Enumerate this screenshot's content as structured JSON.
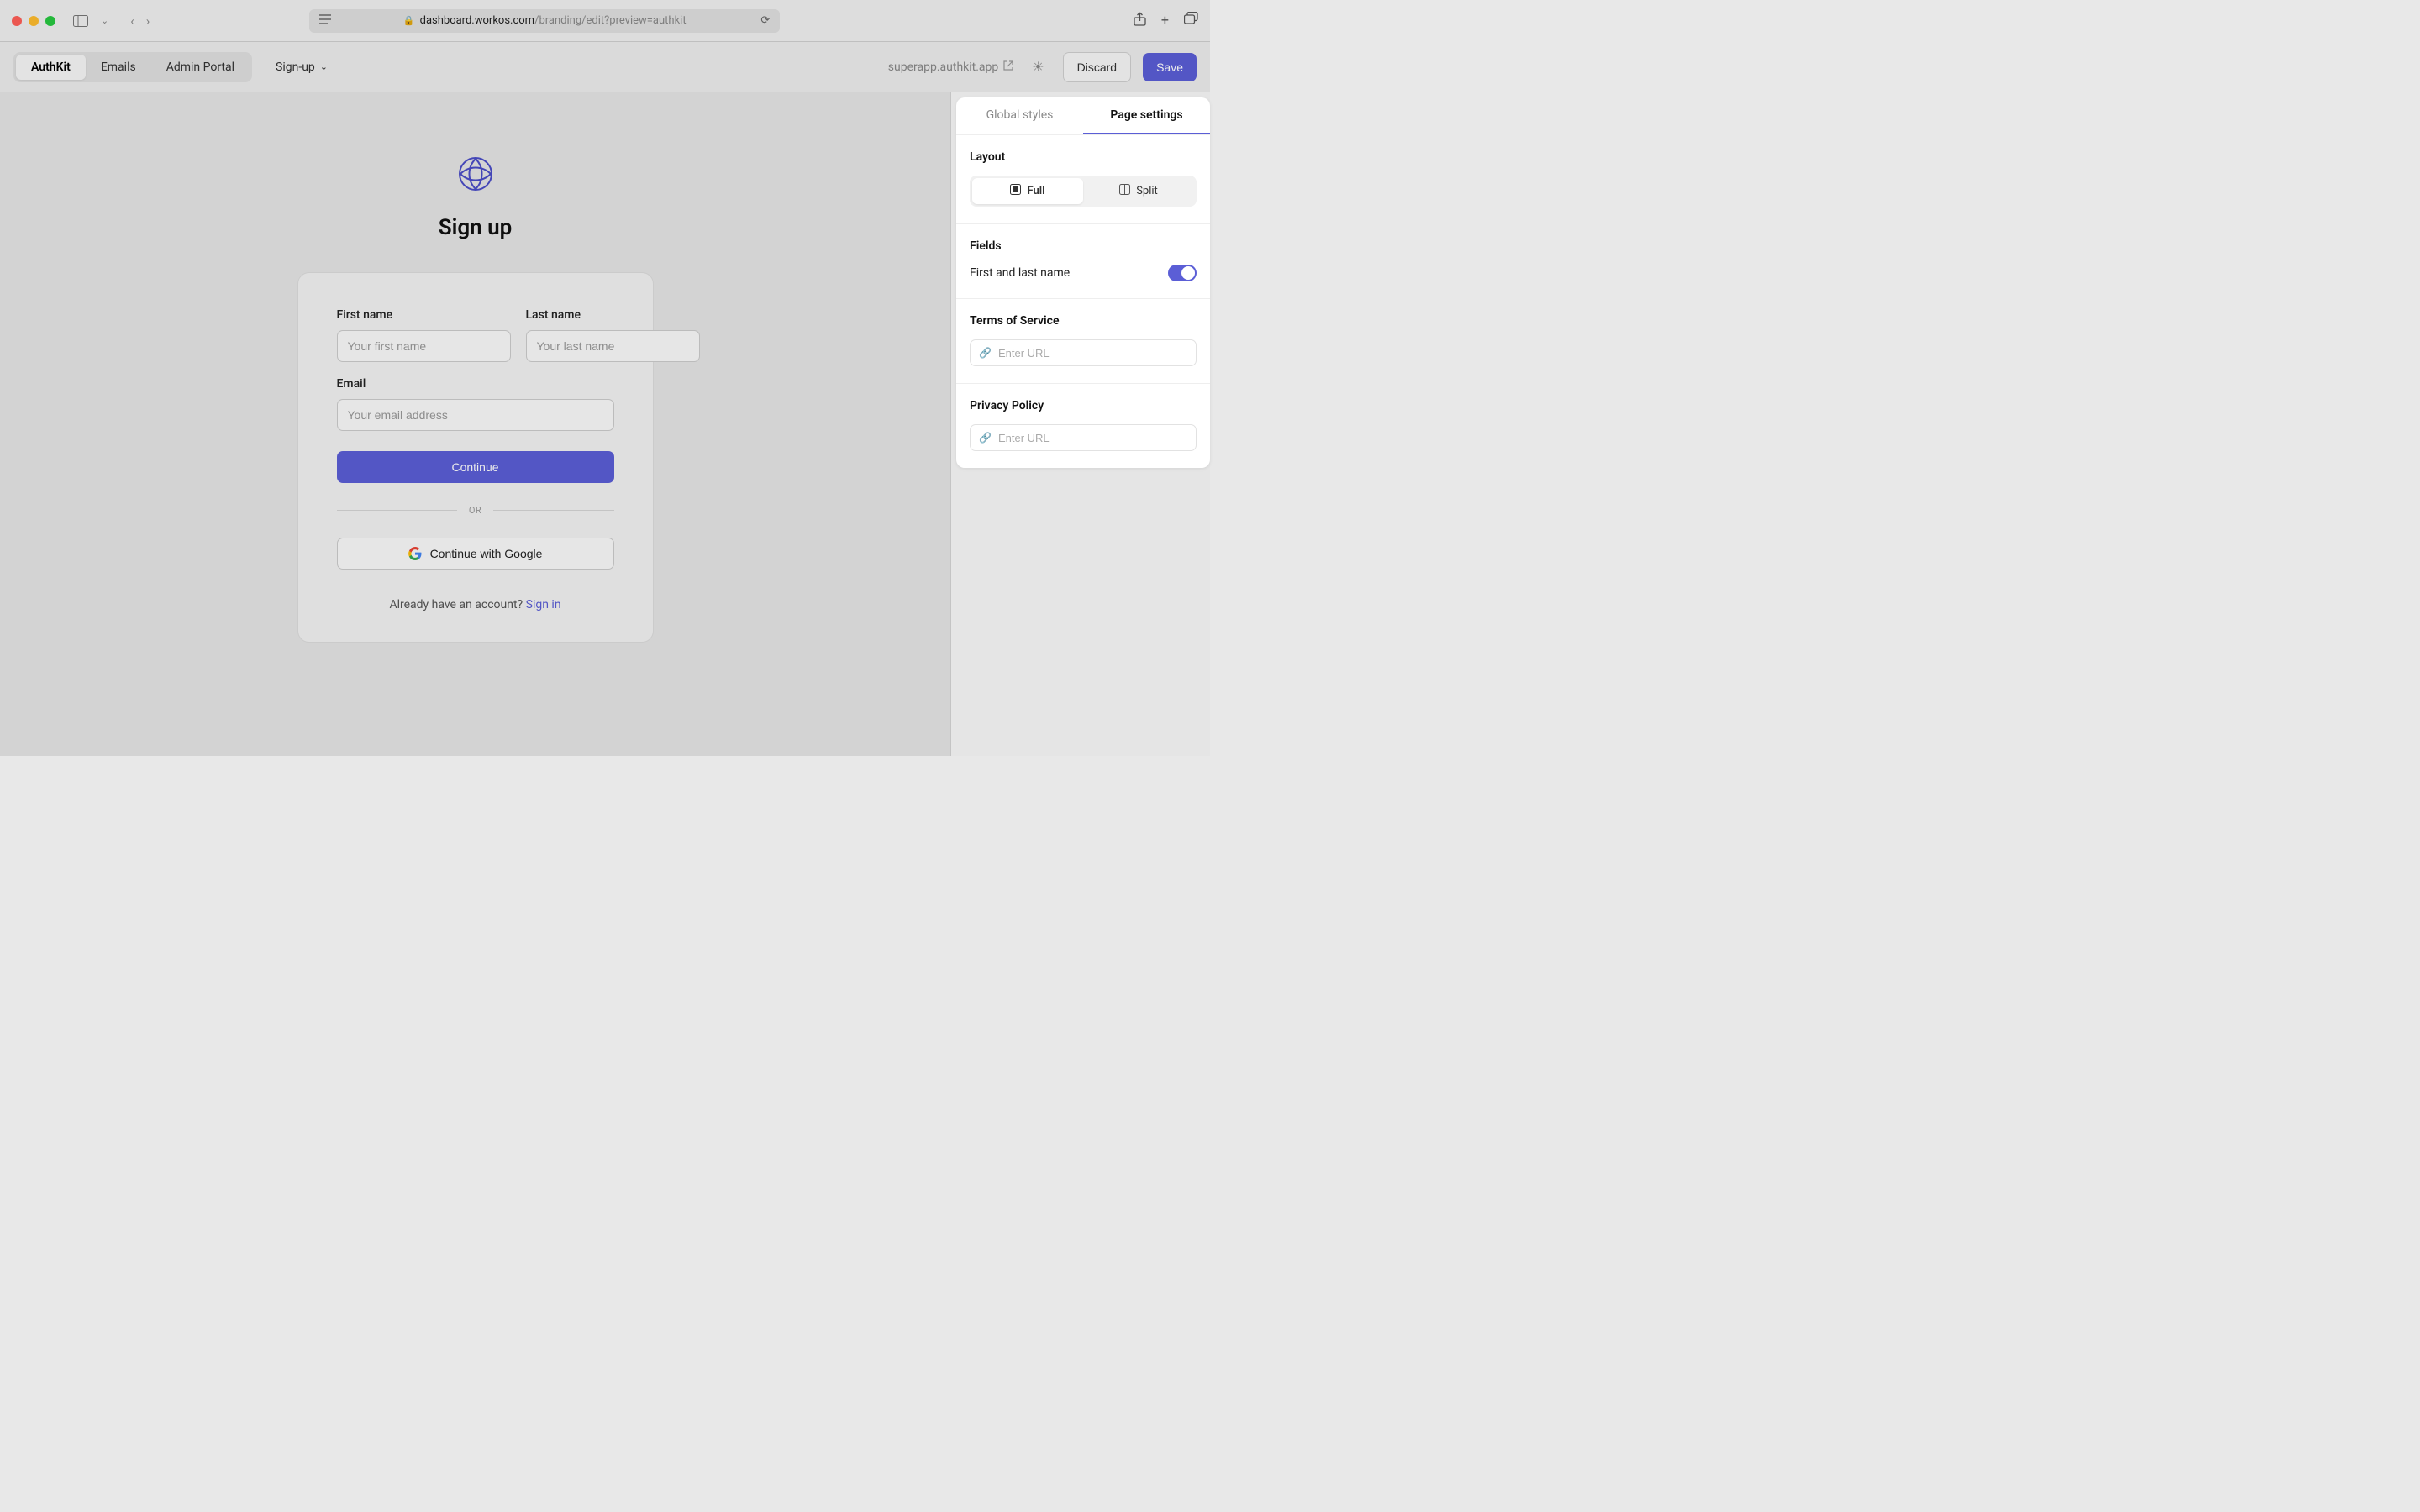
{
  "browser": {
    "url_domain": "dashboard.workos.com",
    "url_path": "/branding/edit?preview=authkit"
  },
  "header": {
    "tabs": [
      "AuthKit",
      "Emails",
      "Admin Portal"
    ],
    "active_tab": "AuthKit",
    "page_select": "Sign-up",
    "preview_domain": "superapp.authkit.app",
    "discard": "Discard",
    "save": "Save"
  },
  "preview": {
    "title": "Sign up",
    "first_name_label": "First name",
    "first_name_placeholder": "Your first name",
    "last_name_label": "Last name",
    "last_name_placeholder": "Your last name",
    "email_label": "Email",
    "email_placeholder": "Your email address",
    "continue": "Continue",
    "or": "OR",
    "google": "Continue with Google",
    "already_text": "Already have an account? ",
    "signin": "Sign in"
  },
  "panel": {
    "tabs": [
      "Global styles",
      "Page settings"
    ],
    "layout_title": "Layout",
    "layout_full": "Full",
    "layout_split": "Split",
    "fields_title": "Fields",
    "fields_toggle_label": "First and last name",
    "tos_title": "Terms of Service",
    "tos_placeholder": "Enter URL",
    "privacy_title": "Privacy Policy",
    "privacy_placeholder": "Enter URL"
  }
}
